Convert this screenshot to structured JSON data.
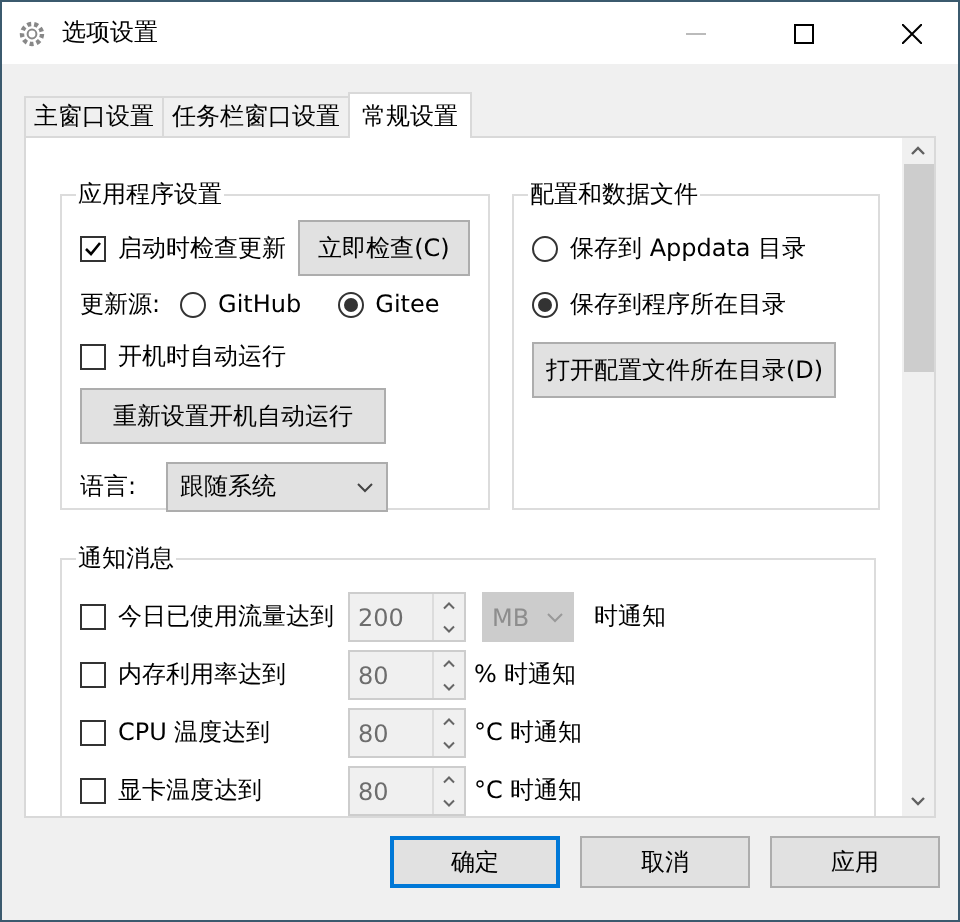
{
  "window": {
    "title": "选项设置"
  },
  "tabs": [
    {
      "label": "主窗口设置",
      "selected": false
    },
    {
      "label": "任务栏窗口设置",
      "selected": false
    },
    {
      "label": "常规设置",
      "selected": true
    }
  ],
  "app_settings": {
    "title": "应用程序设置",
    "check_update": {
      "label": "启动时检查更新",
      "checked": true
    },
    "check_now_button": "立即检查(C)",
    "update_source": {
      "label": "更新源:",
      "options": [
        {
          "label": "GitHub",
          "selected": false
        },
        {
          "label": "Gitee",
          "selected": true
        }
      ]
    },
    "auto_run": {
      "label": "开机时自动运行",
      "checked": false
    },
    "reset_autorun_button": "重新设置开机自动运行",
    "language": {
      "label": "语言:",
      "value": "跟随系统"
    }
  },
  "data_files": {
    "title": "配置和数据文件",
    "options": [
      {
        "label": "保存到 Appdata 目录",
        "selected": false
      },
      {
        "label": "保存到程序所在目录",
        "selected": true
      }
    ],
    "open_button": "打开配置文件所在目录(D)"
  },
  "notifications": {
    "title": "通知消息",
    "rows": [
      {
        "label": "今日已使用流量达到",
        "checked": false,
        "value": "200",
        "unit": "MB",
        "suffix": "时通知",
        "disabled": true
      },
      {
        "label": "内存利用率达到",
        "checked": false,
        "value": "80",
        "suffix": "% 时通知",
        "disabled": true
      },
      {
        "label": "CPU 温度达到",
        "checked": false,
        "value": "80",
        "suffix": "°C 时通知",
        "disabled": true
      },
      {
        "label": "显卡温度达到",
        "checked": false,
        "value": "80",
        "suffix": "°C 时通知",
        "disabled": true
      }
    ]
  },
  "buttons": [
    {
      "label": "确定",
      "default": true
    },
    {
      "label": "取消",
      "default": false
    },
    {
      "label": "应用",
      "default": false
    }
  ]
}
